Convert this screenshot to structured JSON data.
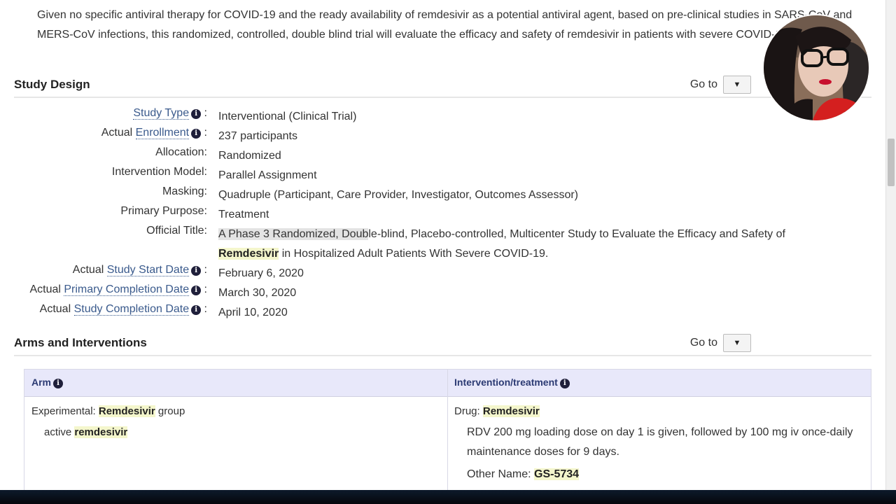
{
  "intro_text": "Given no specific antiviral therapy for COVID-19 and the ready availability of remdesivir as a potential antiviral agent, based on pre-clinical studies in SARS-CoV and MERS-CoV infections, this randomized, controlled, double blind trial will evaluate the efficacy and safety of remdesivir in patients with severe COVID-19.",
  "goto_label": "Go to",
  "study_design": {
    "heading": "Study Design",
    "rows": {
      "study_type": {
        "label": "Study Type",
        "value": "Interventional  (Clinical Trial)"
      },
      "enrollment": {
        "prefix": "Actual ",
        "label": "Enrollment",
        "value": "237 participants"
      },
      "allocation": {
        "label": "Allocation:",
        "value": "Randomized"
      },
      "intervention_model": {
        "label": "Intervention Model:",
        "value": "Parallel Assignment"
      },
      "masking": {
        "label": "Masking:",
        "value": "Quadruple (Participant, Care Provider, Investigator, Outcomes Assessor)"
      },
      "primary_purpose": {
        "label": "Primary Purpose:",
        "value": "Treatment"
      },
      "official_title": {
        "label": "Official Title:",
        "highlighted": "A Phase 3 Randomized, Doub",
        "rest_line1": "le-blind, Placebo-controlled, Multicenter Study to Evaluate the Efficacy and Safety of",
        "keyword": "Remdesivir",
        "rest_line2": " in Hospitalized Adult Patients With Severe COVID-19."
      },
      "start_date": {
        "prefix": "Actual ",
        "label": "Study Start Date",
        "value": "February 6, 2020"
      },
      "primary_completion": {
        "prefix": "Actual ",
        "label": "Primary Completion Date",
        "value": "March 30, 2020"
      },
      "study_completion": {
        "prefix": "Actual ",
        "label": "Study Completion Date",
        "value": "April 10, 2020"
      }
    },
    "colon": " :"
  },
  "arms": {
    "heading": "Arms and Interventions",
    "col_arm": "Arm",
    "col_intervention": "Intervention/treatment",
    "arm_type": "Experimental: ",
    "arm_name": "Remdesivir",
    "arm_suffix": " group",
    "arm_desc_prefix": "active ",
    "arm_desc_keyword": "remdesivir",
    "drug_prefix": "Drug: ",
    "drug_name": "Remdesivir",
    "drug_desc": "RDV 200 mg loading dose on day 1 is given, followed by 100 mg iv once-daily maintenance doses for 9 days.",
    "other_name_label": "Other Name: ",
    "other_name_value": "GS-5734"
  },
  "icons": {
    "info": "info-icon",
    "dropdown": "caret-down-icon"
  },
  "info_glyph": "i",
  "caret_glyph": "▼",
  "colors": {
    "link": "#3a5a8c",
    "keyword_bg": "#f4f6cc",
    "table_header_bg": "#e8e8fa"
  }
}
